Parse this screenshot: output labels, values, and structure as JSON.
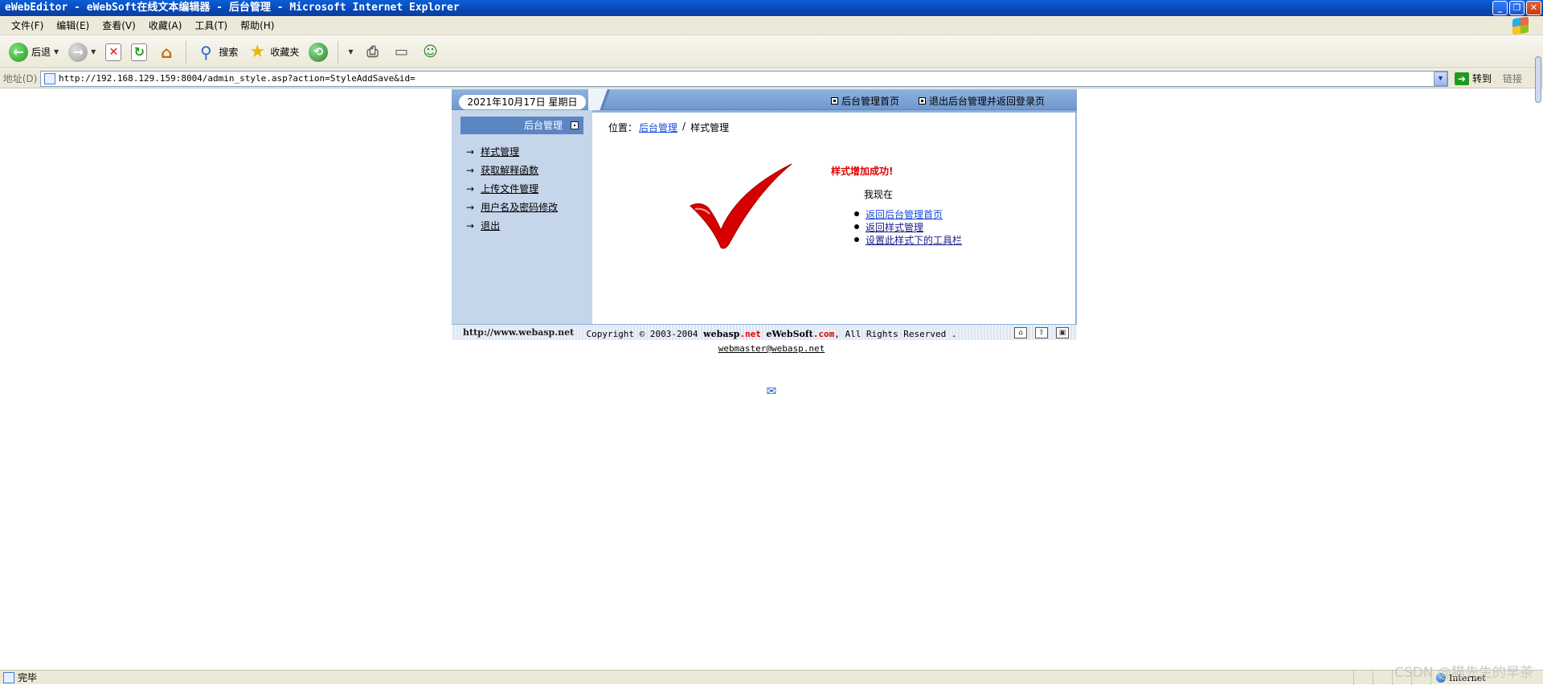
{
  "window": {
    "title": "eWebEditor - eWebSoft在线文本编辑器 - 后台管理 - Microsoft Internet Explorer",
    "controls": [
      "_",
      "❐",
      "✕"
    ]
  },
  "menubar": {
    "items": [
      "文件(F)",
      "编辑(E)",
      "查看(V)",
      "收藏(A)",
      "工具(T)",
      "帮助(H)"
    ]
  },
  "toolbar": {
    "back_label": "后退",
    "search_label": "搜索",
    "favorites_label": "收藏夹"
  },
  "addressbar": {
    "label": "地址(D)",
    "url": "http://192.168.129.159:8004/admin_style.asp?action=StyleAddSave&id=",
    "go_label": "转到",
    "links_label": "链接"
  },
  "page": {
    "date": "2021年10月17日  星期日",
    "top_links": [
      "后台管理首页",
      "退出后台管理并返回登录页"
    ],
    "panel_title": "后台管理",
    "nav": [
      "样式管理",
      "获取解释函数",
      "上传文件管理",
      "用户名及密码修改",
      "退出"
    ],
    "breadcrumb": {
      "prefix": "位置：",
      "link": "后台管理",
      "sep": "/",
      "current": "样式管理"
    },
    "success_message": "样式增加成功!",
    "now_label": "我现在",
    "actions": [
      "返回后台管理首页",
      "返回样式管理",
      "设置此样式下的工具栏"
    ],
    "footer_url": "http://www.webasp.net",
    "copyright": {
      "prefix": "Copyright © 2003-2004 ",
      "site1": "webasp",
      "site1_dot": ".net",
      "site2": "eWebSoft",
      "site2_dot": ".com",
      "suffix": ", All Rights Reserved ."
    },
    "email": "webmaster@webasp.net"
  },
  "statusbar": {
    "text": "完毕",
    "zone": "Internet"
  },
  "watermark": "CSDN @猫先生的早茶",
  "colors": {
    "success": "#e00000",
    "link": "#1b4bd6",
    "panel_bg": "#c5d5ea",
    "header_blue": "#5b86c2"
  }
}
